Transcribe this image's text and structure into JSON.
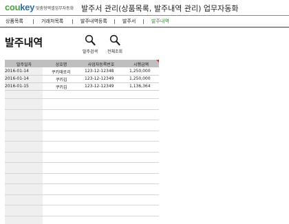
{
  "header": {
    "logo_main": "cou",
    "logo_accent": "key",
    "tagline": "맞춤형엑셀업무자동화",
    "title": "발주서 관리(상품목록, 발주내역 관리) 업무자동화"
  },
  "nav": {
    "items": [
      {
        "label": "상품목록",
        "active": false
      },
      {
        "label": "거래처목록",
        "active": false
      },
      {
        "label": "발주내역등록",
        "active": false
      },
      {
        "label": "발주서",
        "active": false
      },
      {
        "label": "발주내역",
        "active": true
      }
    ]
  },
  "page": {
    "title": "발주내역"
  },
  "buttons": {
    "order_search": {
      "label": "발주검색",
      "icon": "search-icon"
    },
    "view_all": {
      "label": "전체조회",
      "icon": "search-icon"
    }
  },
  "table": {
    "columns": [
      "발주일자",
      "상호명",
      "사업자등록번호",
      "시행금액"
    ],
    "rows": [
      [
        "2016-01-14",
        "쿠키때로리",
        "123-12-12348",
        "1,250,000"
      ],
      [
        "2016-01-14",
        "쿠키김",
        "123-12-12349",
        "1,250,000"
      ],
      [
        "2016-01-15",
        "쿠키김",
        "123-12-12349",
        "1,136,364"
      ]
    ]
  },
  "colors": {
    "logo_green": "#4aa03f",
    "logo_blue": "#2e6f9e",
    "active_nav": "#3a8a3a",
    "header_fill": "#bfbfbf",
    "marker_red": "#e03030"
  }
}
